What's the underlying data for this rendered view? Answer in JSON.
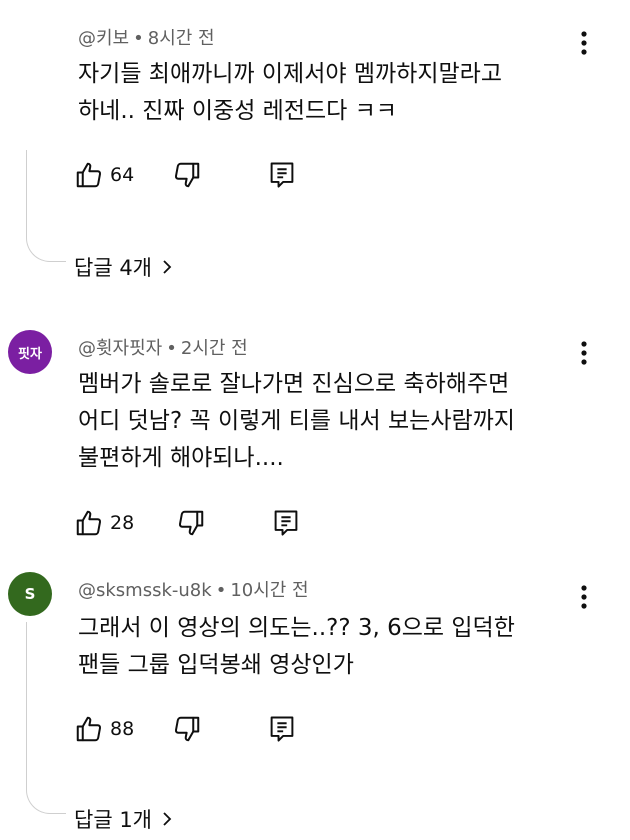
{
  "comments": [
    {
      "author": "@키보",
      "time": "8시간 전",
      "avatar_text": "",
      "lines": [
        "자기들 최애까니까 이제서야 멤까하지말라고",
        "하네.. 진짜 이중성 레전드다 ㅋㅋ"
      ],
      "likes": "64",
      "replies_label": "답글 4개"
    },
    {
      "author": "@휫자핏자",
      "time": "2시간 전",
      "avatar_text": "핏자",
      "avatar_color": "#7b1fa2",
      "lines": [
        "멤버가 솔로로 잘나가면 진심으로 축하해주면",
        "어디 덧남? 꼭 이렇게 티를 내서 보는사람까지",
        "불편하게 해야되나...."
      ],
      "likes": "28"
    },
    {
      "author": "@sksmssk-u8k",
      "time": "10시간 전",
      "avatar_text": "S",
      "avatar_color": "#33691e",
      "lines": [
        "그래서 이 영상의 의도는..?? 3, 6으로 입덕한",
        "팬들 그룹 입덕봉쇄 영상인가"
      ],
      "likes": "88",
      "replies_label": "답글 1개"
    }
  ],
  "separator": "•",
  "icons": {
    "like": "thumbs-up-icon",
    "dislike": "thumbs-down-icon",
    "reply": "reply-icon",
    "more": "more-vert-icon",
    "chevron": "chevron-right-icon"
  }
}
